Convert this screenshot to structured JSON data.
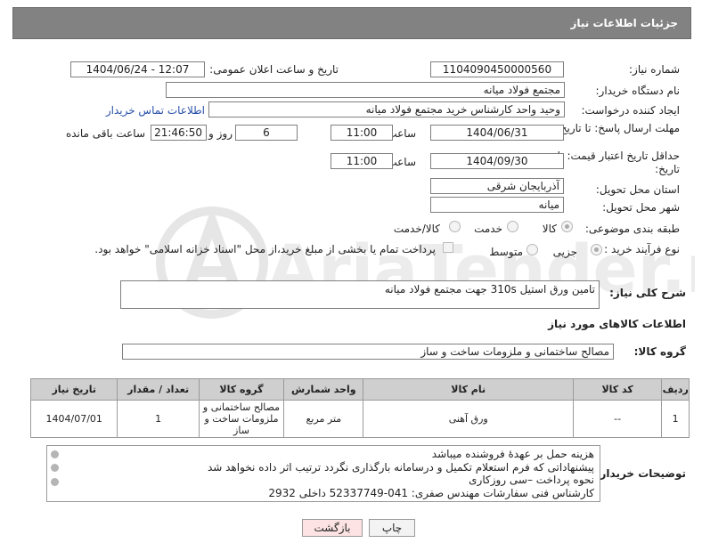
{
  "header": {
    "title": "جزئیات اطلاعات نیاز"
  },
  "fields": {
    "need_number_label": "شماره نیاز:",
    "need_number": "1104090450000560",
    "announce_label": "تاریخ و ساعت اعلان عمومی:",
    "announce_value": "1404/06/24 - 12:07",
    "buyer_org_label": "نام دستگاه خریدار:",
    "buyer_org": "مجتمع فولاد میانه",
    "requester_label": "ایجاد کننده درخواست:",
    "requester": "وحید واحد کارشناس خرید مجتمع فولاد میانه",
    "contact_link": "اطلاعات تماس خریدار",
    "reply_deadline_label": "مهلت ارسال پاسخ: تا تاریخ:",
    "reply_date": "1404/06/31",
    "time_label": "ساعت",
    "reply_time": "11:00",
    "days_value": "6",
    "days_label": "روز و",
    "remaining_time": "21:46:50",
    "remaining_label": "ساعت باقی مانده",
    "price_deadline_label": "حداقل تاریخ اعتبار قیمت: تا تاریخ:",
    "price_date": "1404/09/30",
    "price_time": "11:00",
    "province_label": "استان محل تحویل:",
    "province": "آذربایجان شرقی",
    "city_label": "شهر محل تحویل:",
    "city": "میانه",
    "category_label": "طبقه بندی موضوعی:",
    "category_options": [
      "کالا",
      "خدمت",
      "کالا/خدمت"
    ],
    "category_selected": "کالا",
    "process_label": "نوع فرآیند خرید :",
    "process_options": [
      "جزیی",
      "متوسط"
    ],
    "process_selected": "جزیی",
    "payment_note": "پرداخت تمام یا بخشی از مبلغ خرید،از محل \"اسناد خزانه اسلامی\" خواهد بود."
  },
  "description": {
    "label": "شرح کلی نیاز:",
    "value": "تامین ورق استیل 310s جهت مجتمع فولاد میانه"
  },
  "goods": {
    "section_title": "اطلاعات کالاهای مورد نیاز",
    "group_label": "گروه کالا:",
    "group_value": "مصالح ساختمانی و ملزومات ساخت و ساز",
    "columns": [
      "ردیف",
      "کد کالا",
      "نام کالا",
      "واحد شمارش",
      "گروه کالا",
      "تعداد / مقدار",
      "تاریخ نیاز"
    ],
    "rows": [
      [
        "1",
        "--",
        "ورق آهنی",
        "متر مربع",
        "مصالح ساختمانی و ملزومات ساخت و ساز",
        "1",
        "1404/07/01"
      ]
    ]
  },
  "notes": {
    "label": "توضیحات خریدار:",
    "lines": [
      "هزینه حمل بر عهدهٔ فروشنده میباشد",
      "پیشنهاداتی که فرم استعلام تکمیل و درسامانه بارگذاری نگردد ترتیب اثر داده نخواهد شد",
      "نحوه پرداخت –سی روزکاری",
      "کارشناس فنی سفارشات مهندس صفری:  041-52337749  داخلی 2932"
    ]
  },
  "buttons": {
    "print": "چاپ",
    "back": "بازگشت"
  },
  "watermark": {
    "text": "AriaTender.neT"
  },
  "colors": {
    "header_bg": "#828282",
    "table_header_bg": "#cfcfcf",
    "link": "#2850a8",
    "back_button_bg": "#fde3e3"
  }
}
